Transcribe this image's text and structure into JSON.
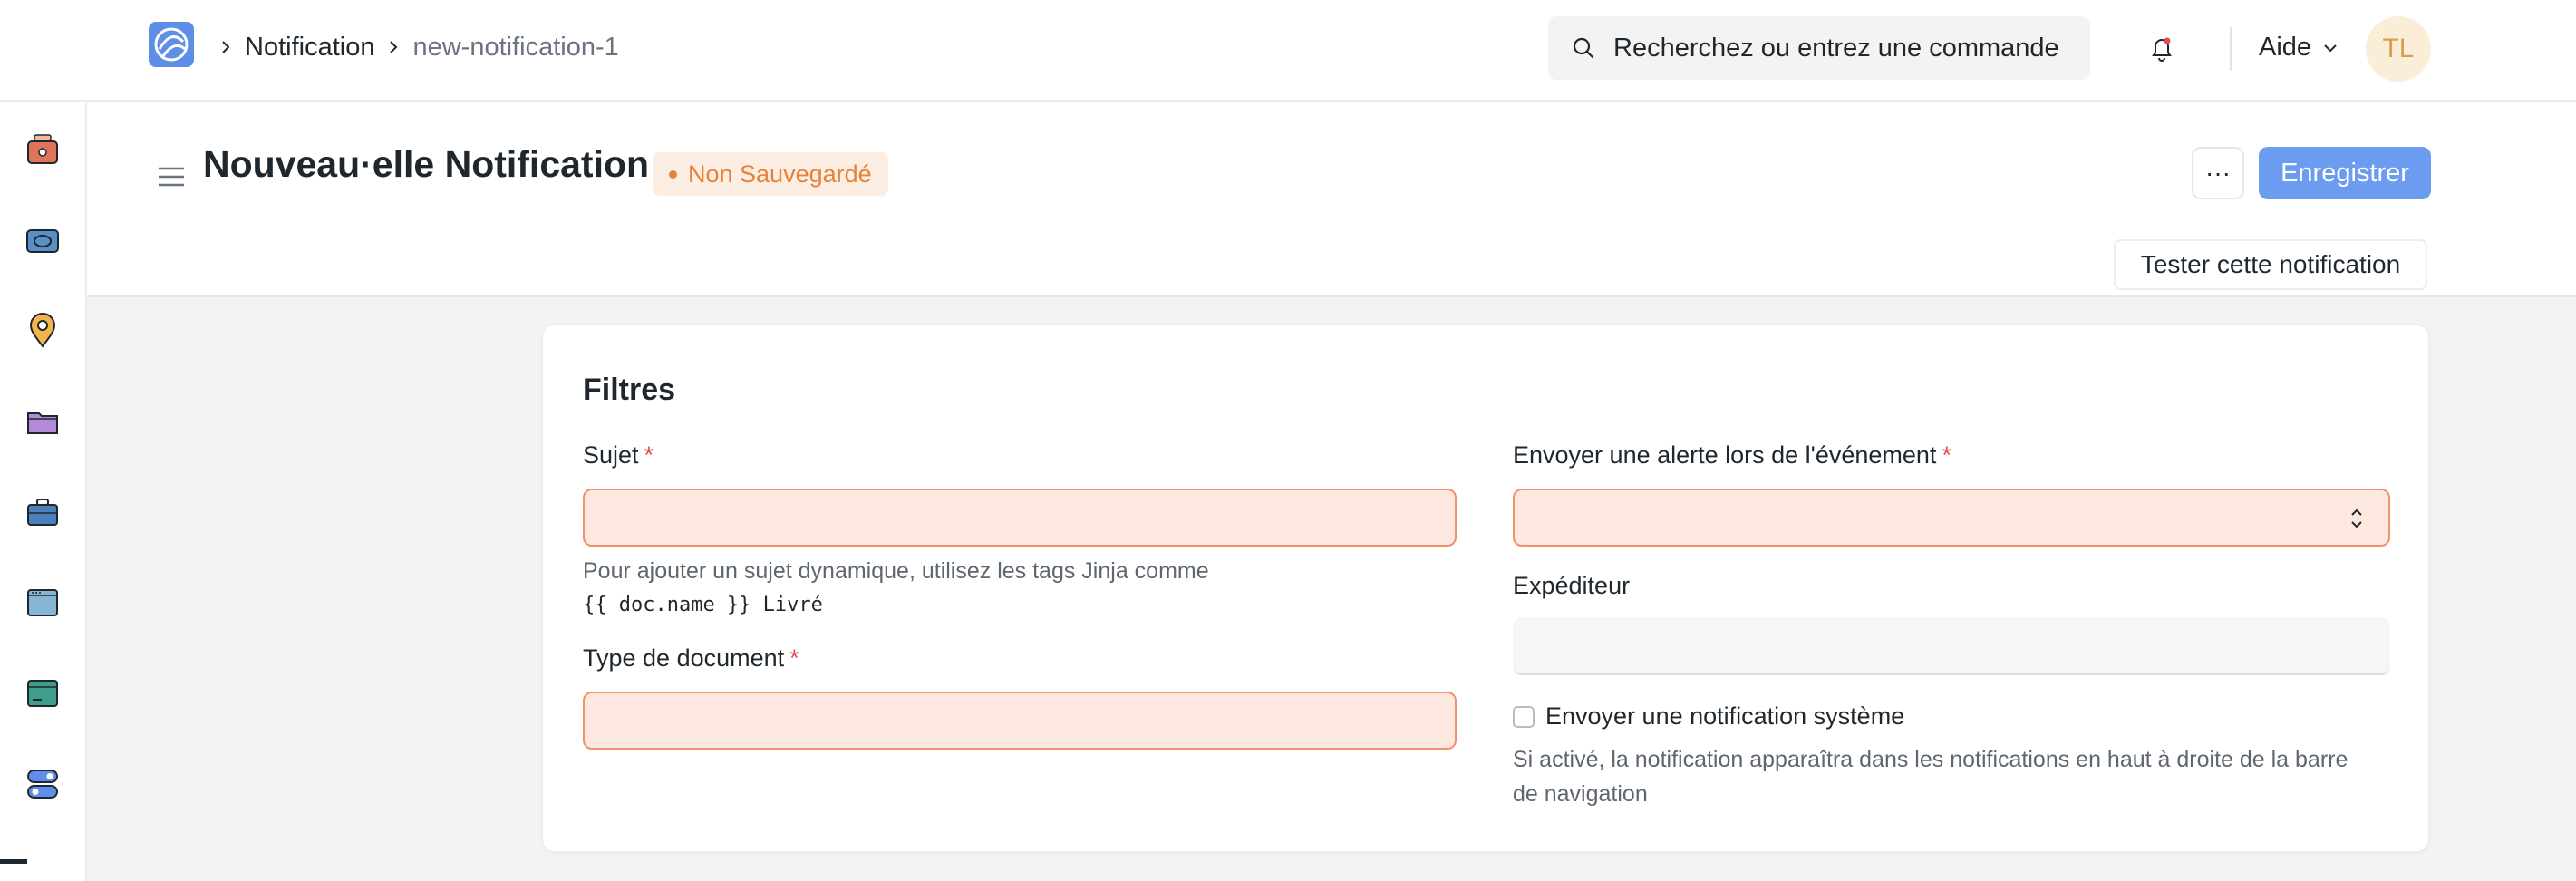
{
  "breadcrumb": {
    "items": [
      "Notification",
      "new-notification-1"
    ]
  },
  "search": {
    "text": "Recherchez ou entrez une commande"
  },
  "header": {
    "help_label": "Aide",
    "avatar_initials": "TL"
  },
  "page": {
    "title": "Nouveau·elle Notification",
    "status_badge": "Non Sauvegardé",
    "more_label": "···",
    "save_label": "Enregistrer",
    "test_label": "Tester cette notification"
  },
  "form": {
    "section_title": "Filtres",
    "subject": {
      "label": "Sujet",
      "required": "*",
      "value": "",
      "help_line1": "Pour ajouter un sujet dynamique, utilisez les tags Jinja comme",
      "help_code": "{{ doc.name }} Livré"
    },
    "doctype": {
      "label": "Type de document",
      "required": "*",
      "value": ""
    },
    "event": {
      "label": "Envoyer une alerte lors de l'événement",
      "required": "*",
      "value": ""
    },
    "sender": {
      "label": "Expéditeur",
      "value": ""
    },
    "system_notification": {
      "label": "Envoyer une notification système",
      "checked": false,
      "help_line1": "Si activé, la notification apparaîtra dans les notifications en haut à droite de la barre",
      "help_line2": "de navigation"
    }
  },
  "sidebar": {
    "icons": [
      "wallet-icon",
      "card-icon",
      "location-pin-icon",
      "folder-icon",
      "briefcase-icon",
      "window-icon",
      "terminal-icon",
      "toggle-icon"
    ]
  },
  "colors": {
    "primary": "#6b9cf0",
    "warning": "#e8823a",
    "required": "#e24c4c",
    "invalid_bg": "#fde8df"
  }
}
